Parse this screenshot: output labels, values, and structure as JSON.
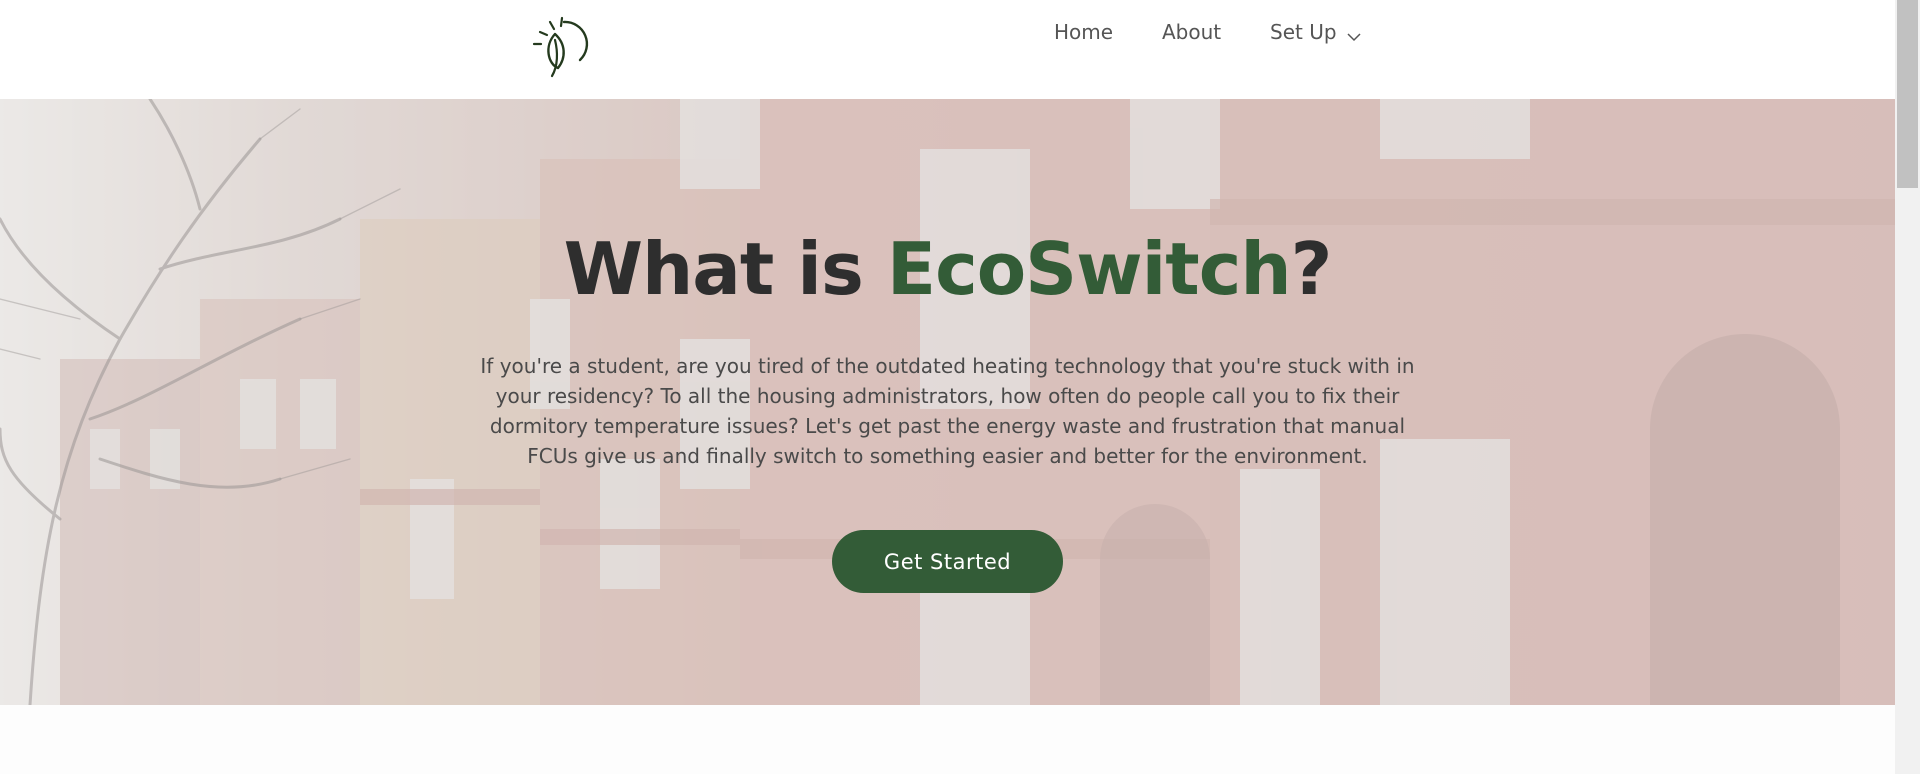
{
  "nav": {
    "home": "Home",
    "about": "About",
    "setup": "Set Up"
  },
  "hero": {
    "title_prefix": "What is ",
    "title_brand": "EcoSwitch",
    "title_suffix": "?",
    "description": "If you're a student, are you tired of the outdated heating technology that you're stuck with in your residency? To all the housing administrators, how often do people call you to fix their dormitory temperature issues? Let's get past the energy waste and frustration that manual FCUs give us and finally switch to something easier and better for the environment.",
    "cta_label": "Get Started"
  },
  "icons": {
    "logo": "leaf-sun-icon",
    "dropdown": "chevron-down-icon"
  },
  "colors": {
    "brand_green": "#335c37",
    "title_dark": "#2e2e2e",
    "nav_text": "#555555"
  }
}
